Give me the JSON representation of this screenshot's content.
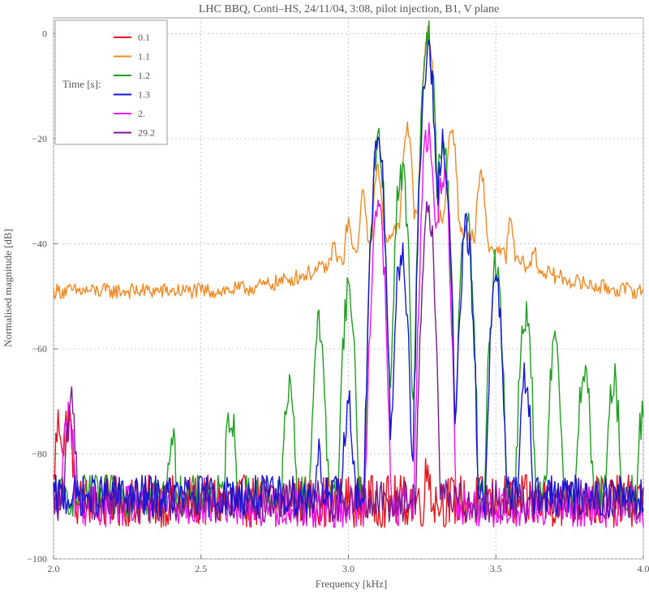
{
  "chart_data": {
    "type": "line",
    "title": "LHC BBQ,  Conti–HS,  24/11/04,  3:08,  pilot injection,  B1,  V plane",
    "xlabel": "Frequency  [kHz]",
    "ylabel": "Normalised  magnitude  [dB]",
    "xlim": [
      2.0,
      4.0
    ],
    "ylim": [
      -100,
      3
    ],
    "xticks": [
      "2.0",
      "2.5",
      "3.0",
      "3.5",
      "4.0"
    ],
    "xtick_values": [
      2.0,
      2.5,
      3.0,
      3.5,
      4.0
    ],
    "yticks": [
      "0",
      "−20",
      "−40",
      "−60",
      "−80",
      "−100"
    ],
    "ytick_values": [
      0,
      -20,
      -40,
      -60,
      -80,
      -100
    ],
    "grid": true,
    "legend_title": "Time  [s]:",
    "legend_position": "top-left",
    "series": [
      {
        "name": "0.1",
        "color": "#e8141c",
        "baseline": -89,
        "noise": 5,
        "peaks": [
          [
            2.02,
            -74
          ],
          [
            2.05,
            -73
          ],
          [
            3.27,
            -83
          ]
        ]
      },
      {
        "name": "1.1",
        "color": "#f08a24",
        "baseline": -49,
        "noise": 1.5,
        "peaks": [
          [
            2.95,
            -40
          ],
          [
            3.0,
            -36
          ],
          [
            3.05,
            -31
          ],
          [
            3.1,
            -26
          ],
          [
            3.2,
            -18
          ],
          [
            3.27,
            0
          ],
          [
            3.35,
            -18
          ],
          [
            3.45,
            -27
          ],
          [
            3.55,
            -36
          ],
          [
            3.63,
            -41
          ],
          [
            3.75,
            -49
          ],
          [
            4.0,
            -56
          ]
        ]
      },
      {
        "name": "1.2",
        "color": "#1f9e1f",
        "baseline": -88,
        "noise": 4,
        "peaks": [
          [
            2.4,
            -77
          ],
          [
            2.6,
            -72
          ],
          [
            2.8,
            -68
          ],
          [
            2.9,
            -56
          ],
          [
            3.0,
            -49
          ],
          [
            3.1,
            -21
          ],
          [
            3.18,
            -26
          ],
          [
            3.27,
            -1
          ],
          [
            3.32,
            -21
          ],
          [
            3.4,
            -36
          ],
          [
            3.5,
            -44
          ],
          [
            3.6,
            -53
          ],
          [
            3.7,
            -60
          ],
          [
            3.8,
            -63
          ],
          [
            3.9,
            -66
          ],
          [
            4.0,
            -72
          ]
        ]
      },
      {
        "name": "1.3",
        "color": "#1414d8",
        "baseline": -88,
        "noise": 4,
        "peaks": [
          [
            2.9,
            -80
          ],
          [
            3.0,
            -71
          ],
          [
            3.1,
            -21
          ],
          [
            3.18,
            -42
          ],
          [
            3.27,
            -4
          ],
          [
            3.32,
            -21
          ],
          [
            3.4,
            -38
          ],
          [
            3.5,
            -48
          ],
          [
            3.6,
            -65
          ]
        ]
      },
      {
        "name": "2.",
        "color": "#f014f0",
        "baseline": -90,
        "noise": 4,
        "peaks": [
          [
            2.05,
            -72
          ],
          [
            3.1,
            -32
          ],
          [
            3.27,
            -19
          ],
          [
            3.32,
            -26
          ]
        ]
      },
      {
        "name": "29.2",
        "color": "#7a1a8e",
        "baseline": -89,
        "noise": 4,
        "peaks": [
          [
            2.06,
            -71
          ],
          [
            3.27,
            -34
          ]
        ]
      }
    ]
  }
}
